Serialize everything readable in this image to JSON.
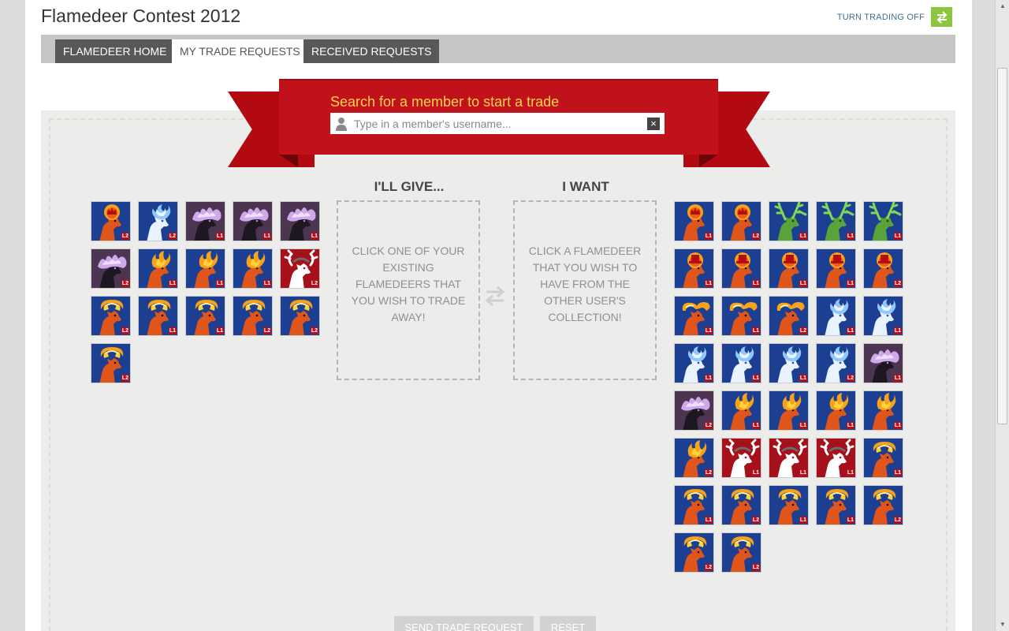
{
  "header": {
    "title": "Flamedeer Contest 2012",
    "trading_toggle_label": "TURN TRADING OFF"
  },
  "tabs": [
    {
      "label": "FLAMEDEER HOME",
      "active": false
    },
    {
      "label": "MY TRADE REQUESTS",
      "active": true
    },
    {
      "label": "RECEIVED REQUESTS",
      "active": false
    }
  ],
  "search": {
    "title": "Search for a member to start a trade",
    "placeholder": "Type in a member's username..."
  },
  "give": {
    "heading": "I'LL GIVE...",
    "instruction": "CLICK ONE OF YOUR EXISTING FLAMEDEERS THAT YOU WISH TO TRADE AWAY!"
  },
  "want": {
    "heading": "I WANT",
    "instruction": "CLICK A FLAMEDEER THAT YOU WISH TO HAVE FROM THE OTHER USER'S COLLECTION!"
  },
  "buttons": {
    "send": "SEND TRADE REQUEST",
    "reset": "RESET"
  },
  "colors": {
    "ribbon": "#c1121c",
    "ribbon_text": "#ffd24a",
    "tab_inactive": "#585858",
    "toggle_green": "#8cc63f",
    "level_badge": "#b4101b"
  },
  "my_flamedeers": [
    {
      "type": "crown",
      "level": "L2"
    },
    {
      "type": "ice",
      "level": "L2"
    },
    {
      "type": "ghost",
      "level": "L1"
    },
    {
      "type": "ghost",
      "level": "L1"
    },
    {
      "type": "ghost",
      "level": "L1"
    },
    {
      "type": "ghost",
      "level": "L2"
    },
    {
      "type": "fire",
      "level": "L1"
    },
    {
      "type": "fire",
      "level": "L1"
    },
    {
      "type": "fire",
      "level": "L1"
    },
    {
      "type": "white",
      "level": "L2"
    },
    {
      "type": "ring",
      "level": "L2"
    },
    {
      "type": "ring",
      "level": "L1"
    },
    {
      "type": "ring",
      "level": "L1"
    },
    {
      "type": "ring",
      "level": "L2"
    },
    {
      "type": "ring",
      "level": "L2"
    },
    {
      "type": "ring",
      "level": "L2"
    }
  ],
  "their_flamedeers": [
    {
      "type": "crown",
      "level": "L1"
    },
    {
      "type": "crown",
      "level": "L2"
    },
    {
      "type": "green",
      "level": "L1"
    },
    {
      "type": "green",
      "level": "L1"
    },
    {
      "type": "green",
      "level": "L1"
    },
    {
      "type": "tophat",
      "level": "L1"
    },
    {
      "type": "tophat",
      "level": "L1"
    },
    {
      "type": "tophat",
      "level": "L1"
    },
    {
      "type": "tophat",
      "level": "L1"
    },
    {
      "type": "tophat",
      "level": "L2"
    },
    {
      "type": "swirl",
      "level": "L1"
    },
    {
      "type": "swirl",
      "level": "L1"
    },
    {
      "type": "swirl",
      "level": "L2"
    },
    {
      "type": "ice",
      "level": "L1"
    },
    {
      "type": "ice",
      "level": "L1"
    },
    {
      "type": "ice",
      "level": "L1"
    },
    {
      "type": "ice",
      "level": "L1"
    },
    {
      "type": "ice",
      "level": "L1"
    },
    {
      "type": "ice",
      "level": "L2"
    },
    {
      "type": "ghost",
      "level": "L1"
    },
    {
      "type": "ghost",
      "level": "L2"
    },
    {
      "type": "fire",
      "level": "L1"
    },
    {
      "type": "fire",
      "level": "L1"
    },
    {
      "type": "fire",
      "level": "L1"
    },
    {
      "type": "fire",
      "level": "L1"
    },
    {
      "type": "fire",
      "level": "L2"
    },
    {
      "type": "white",
      "level": "L1"
    },
    {
      "type": "white",
      "level": "L1"
    },
    {
      "type": "white",
      "level": "L1"
    },
    {
      "type": "ring",
      "level": "L1"
    },
    {
      "type": "ring",
      "level": "L1"
    },
    {
      "type": "ring",
      "level": "L2"
    },
    {
      "type": "ring",
      "level": "L1"
    },
    {
      "type": "ring",
      "level": "L1"
    },
    {
      "type": "ring",
      "level": "L2"
    },
    {
      "type": "ring",
      "level": "L2"
    },
    {
      "type": "ring",
      "level": "L2"
    }
  ]
}
